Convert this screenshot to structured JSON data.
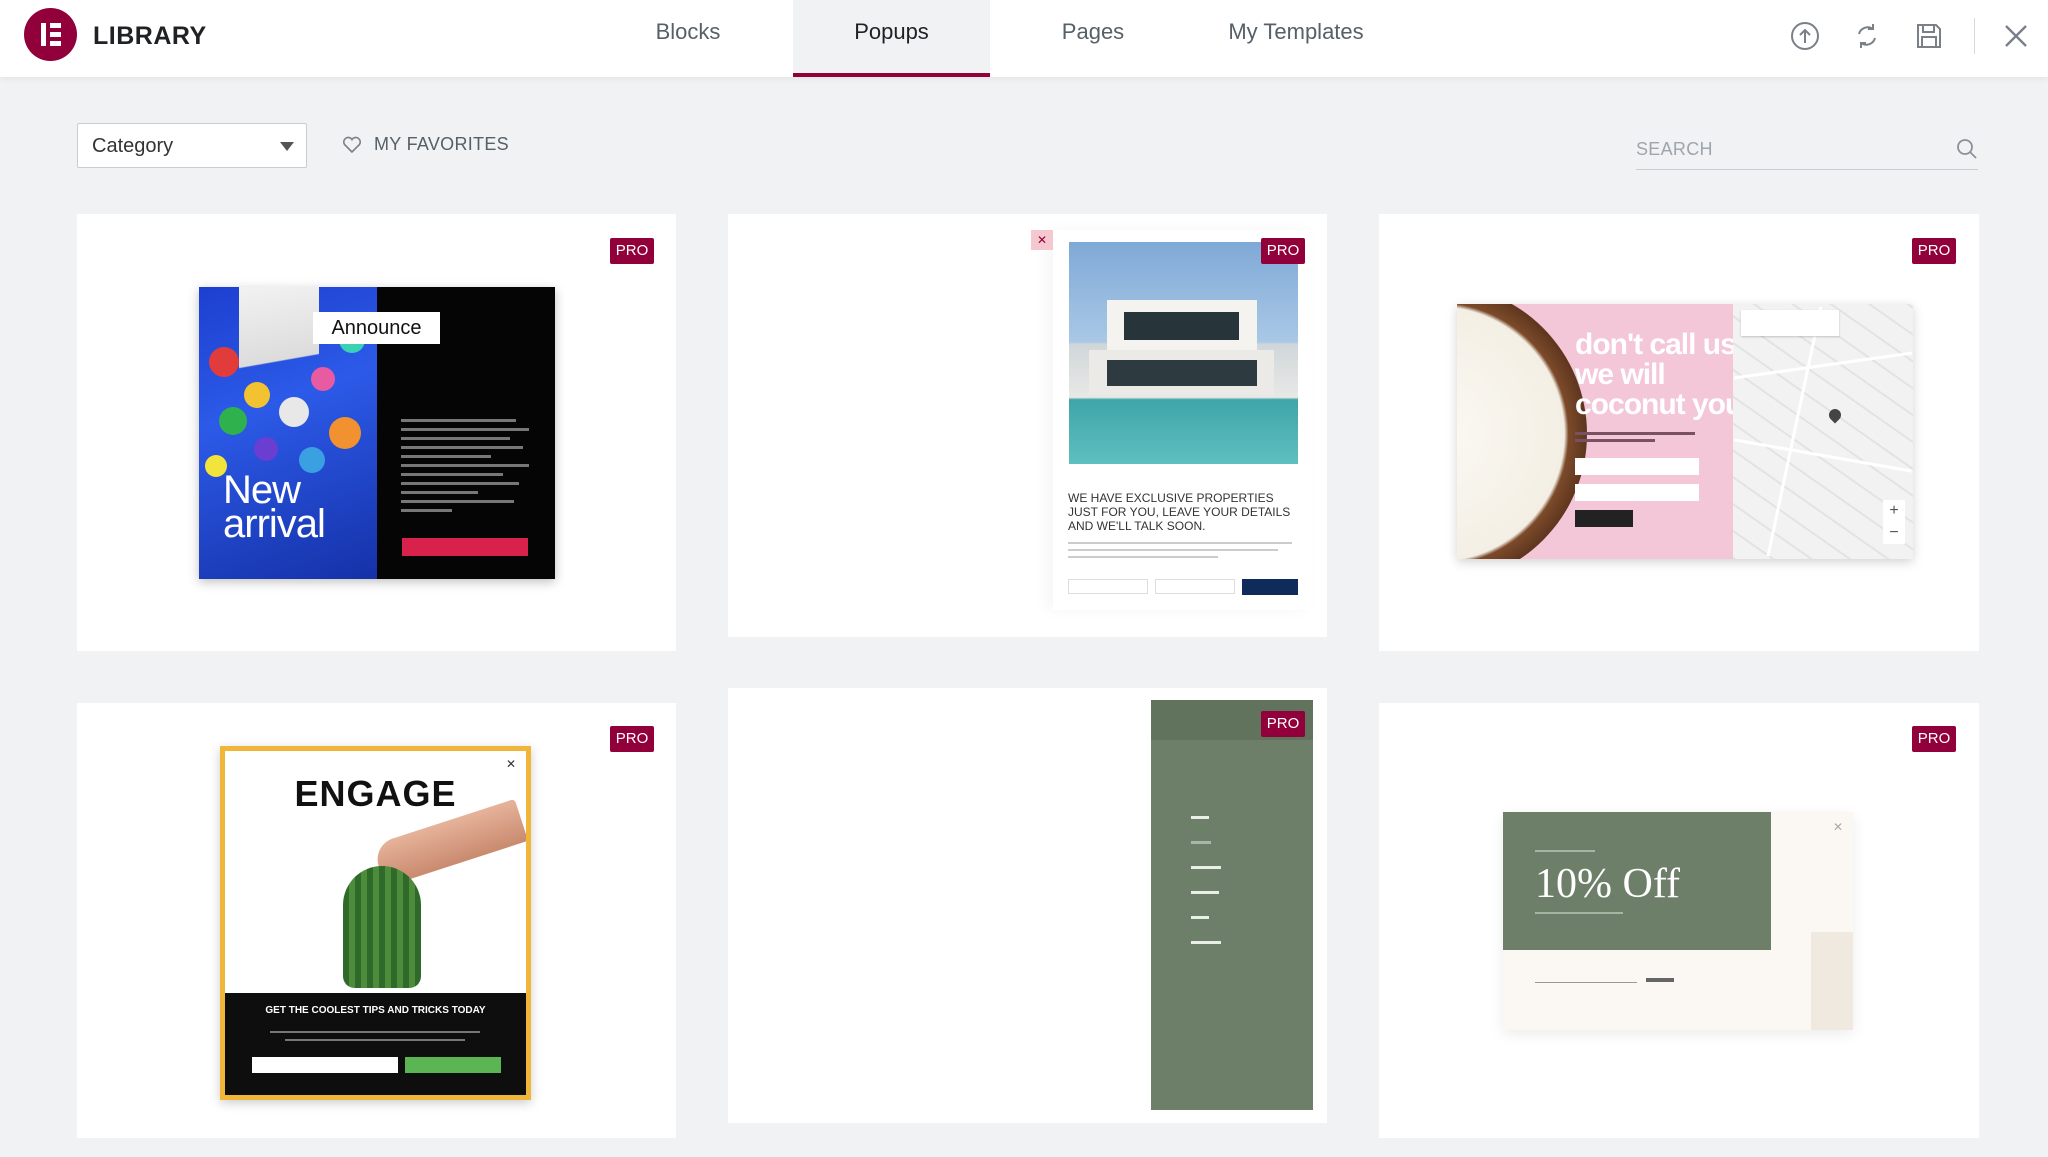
{
  "app": {
    "title": "LIBRARY",
    "brand_color": "#92003b"
  },
  "tabs": [
    {
      "label": "Blocks",
      "active": false
    },
    {
      "label": "Popups",
      "active": true
    },
    {
      "label": "Pages",
      "active": false
    },
    {
      "label": "My Templates",
      "active": false
    }
  ],
  "header_icons": [
    "upload-icon",
    "sync-icon",
    "save-icon",
    "close-icon"
  ],
  "toolbar": {
    "category_value": "Category",
    "favorites_label": "MY FAVORITES",
    "search_placeholder": "SEARCH"
  },
  "cards": [
    {
      "badge": "PRO",
      "preview": {
        "badge_text": "Announce",
        "title_line1": "New",
        "title_line2": "arrival"
      }
    },
    {
      "badge": "PRO",
      "preview": {
        "heading": "WE HAVE EXCLUSIVE PROPERTIES JUST FOR YOU, LEAVE YOUR DETAILS AND WE'LL TALK SOON."
      }
    },
    {
      "badge": "PRO",
      "preview": {
        "heading": "don't call us, we will coconut you"
      }
    },
    {
      "badge": "PRO",
      "preview": {
        "title": "ENGAGE",
        "tagline": "GET THE COOLEST TIPS AND TRICKS TODAY"
      }
    },
    {
      "badge": "PRO",
      "preview": {}
    },
    {
      "badge": "PRO",
      "preview": {
        "headline": "10% Off"
      }
    }
  ]
}
